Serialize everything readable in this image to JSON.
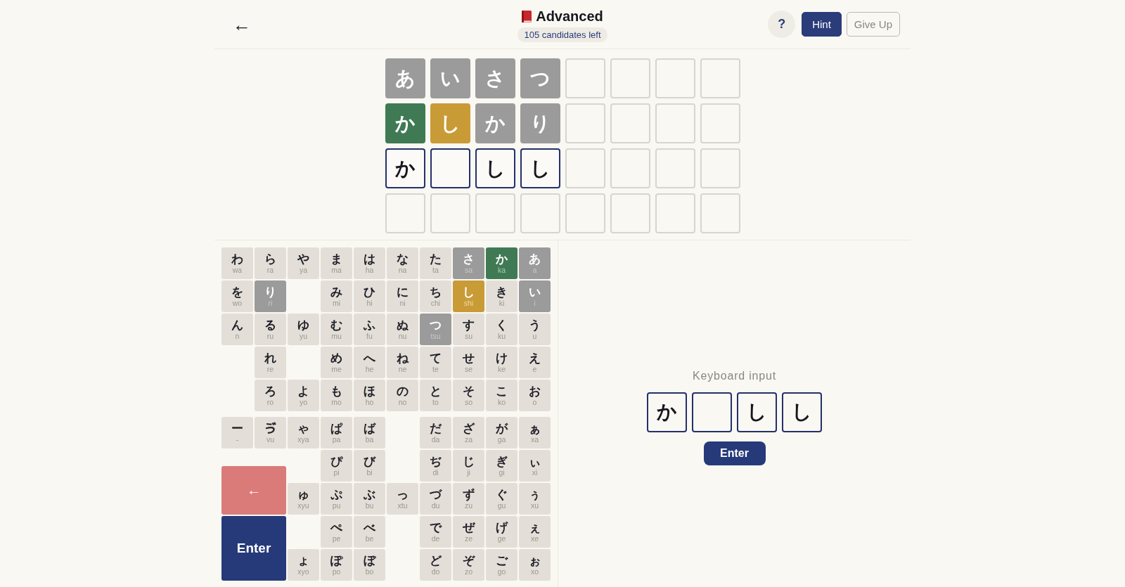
{
  "header": {
    "back": "←",
    "title": "Advanced",
    "badge": "105 candidates left",
    "help": "?",
    "buttons": [
      {
        "label": "Hint",
        "kind": "primary"
      },
      {
        "label": "Give Up",
        "kind": "outline"
      }
    ]
  },
  "board": {
    "rows": [
      [
        {
          "letter": "あ",
          "kind": "absent"
        },
        {
          "letter": "い",
          "kind": "absent"
        },
        {
          "letter": "さ",
          "kind": "absent"
        },
        {
          "letter": "つ",
          "kind": "absent"
        },
        {
          "kind": "empty"
        },
        {
          "kind": "empty"
        },
        {
          "kind": "empty"
        },
        {
          "kind": "empty"
        }
      ],
      [
        {
          "letter": "か",
          "kind": "correct"
        },
        {
          "letter": "し",
          "kind": "present"
        },
        {
          "letter": "か",
          "kind": "absent"
        },
        {
          "letter": "り",
          "kind": "absent"
        },
        {
          "kind": "empty"
        },
        {
          "kind": "empty"
        },
        {
          "kind": "empty"
        },
        {
          "kind": "empty"
        }
      ],
      [
        {
          "letter": "か",
          "kind": "input"
        },
        {
          "kind": "input"
        },
        {
          "letter": "し",
          "kind": "input"
        },
        {
          "letter": "し",
          "kind": "input"
        },
        {
          "kind": "empty"
        },
        {
          "kind": "empty"
        },
        {
          "kind": "empty"
        },
        {
          "kind": "empty"
        }
      ],
      [
        {
          "kind": "empty"
        },
        {
          "kind": "empty"
        },
        {
          "kind": "empty"
        },
        {
          "kind": "empty"
        },
        {
          "kind": "empty"
        },
        {
          "kind": "empty"
        },
        {
          "kind": "empty"
        },
        {
          "kind": "empty"
        }
      ]
    ]
  },
  "keyboard": {
    "main_rows": [
      [
        {
          "kana": "わ",
          "romaji": "wa",
          "kind": "unused"
        },
        {
          "kana": "ら",
          "romaji": "ra",
          "kind": "unused"
        },
        {
          "kana": "や",
          "romaji": "ya",
          "kind": "unused"
        },
        {
          "kana": "ま",
          "romaji": "ma",
          "kind": "unused"
        },
        {
          "kana": "は",
          "romaji": "ha",
          "kind": "unused"
        },
        {
          "kana": "な",
          "romaji": "na",
          "kind": "unused"
        },
        {
          "kana": "た",
          "romaji": "ta",
          "kind": "unused"
        },
        {
          "kana": "さ",
          "romaji": "sa",
          "kind": "absent"
        },
        {
          "kana": "か",
          "romaji": "ka",
          "kind": "correct"
        },
        {
          "kana": "あ",
          "romaji": "a",
          "kind": "absent"
        }
      ],
      [
        {
          "kana": "を",
          "romaji": "wo",
          "kind": "unused"
        },
        {
          "kana": "り",
          "romaji": "ri",
          "kind": "absent"
        },
        null,
        {
          "kana": "み",
          "romaji": "mi",
          "kind": "unused"
        },
        {
          "kana": "ひ",
          "romaji": "hi",
          "kind": "unused"
        },
        {
          "kana": "に",
          "romaji": "ni",
          "kind": "unused"
        },
        {
          "kana": "ち",
          "romaji": "chi",
          "kind": "unused"
        },
        {
          "kana": "し",
          "romaji": "shi",
          "kind": "present"
        },
        {
          "kana": "き",
          "romaji": "ki",
          "kind": "unused"
        },
        {
          "kana": "い",
          "romaji": "i",
          "kind": "absent"
        }
      ],
      [
        {
          "kana": "ん",
          "romaji": "n",
          "kind": "unused"
        },
        {
          "kana": "る",
          "romaji": "ru",
          "kind": "unused"
        },
        {
          "kana": "ゆ",
          "romaji": "yu",
          "kind": "unused"
        },
        {
          "kana": "む",
          "romaji": "mu",
          "kind": "unused"
        },
        {
          "kana": "ふ",
          "romaji": "fu",
          "kind": "unused"
        },
        {
          "kana": "ぬ",
          "romaji": "nu",
          "kind": "unused"
        },
        {
          "kana": "つ",
          "romaji": "tsu",
          "kind": "absent"
        },
        {
          "kana": "す",
          "romaji": "su",
          "kind": "unused"
        },
        {
          "kana": "く",
          "romaji": "ku",
          "kind": "unused"
        },
        {
          "kana": "う",
          "romaji": "u",
          "kind": "unused"
        }
      ],
      [
        null,
        {
          "kana": "れ",
          "romaji": "re",
          "kind": "unused"
        },
        null,
        {
          "kana": "め",
          "romaji": "me",
          "kind": "unused"
        },
        {
          "kana": "へ",
          "romaji": "he",
          "kind": "unused"
        },
        {
          "kana": "ね",
          "romaji": "ne",
          "kind": "unused"
        },
        {
          "kana": "て",
          "romaji": "te",
          "kind": "unused"
        },
        {
          "kana": "せ",
          "romaji": "se",
          "kind": "unused"
        },
        {
          "kana": "け",
          "romaji": "ke",
          "kind": "unused"
        },
        {
          "kana": "え",
          "romaji": "e",
          "kind": "unused"
        }
      ],
      [
        null,
        {
          "kana": "ろ",
          "romaji": "ro",
          "kind": "unused"
        },
        {
          "kana": "よ",
          "romaji": "yo",
          "kind": "unused"
        },
        {
          "kana": "も",
          "romaji": "mo",
          "kind": "unused"
        },
        {
          "kana": "ほ",
          "romaji": "ho",
          "kind": "unused"
        },
        {
          "kana": "の",
          "romaji": "no",
          "kind": "unused"
        },
        {
          "kana": "と",
          "romaji": "to",
          "kind": "unused"
        },
        {
          "kana": "そ",
          "romaji": "so",
          "kind": "unused"
        },
        {
          "kana": "こ",
          "romaji": "ko",
          "kind": "unused"
        },
        {
          "kana": "お",
          "romaji": "o",
          "kind": "unused"
        }
      ]
    ],
    "extra_rows": [
      [
        {
          "kana": "ー",
          "romaji": "-",
          "kind": "unused"
        },
        {
          "kana": "ゔ",
          "romaji": "vu",
          "kind": "unused"
        },
        {
          "kana": "ゃ",
          "romaji": "xya",
          "kind": "unused"
        },
        {
          "kana": "ぱ",
          "romaji": "pa",
          "kind": "unused"
        },
        {
          "kana": "ば",
          "romaji": "ba",
          "kind": "unused"
        },
        null,
        {
          "kana": "だ",
          "romaji": "da",
          "kind": "unused"
        },
        {
          "kana": "ざ",
          "romaji": "za",
          "kind": "unused"
        },
        {
          "kana": "が",
          "romaji": "ga",
          "kind": "unused"
        },
        {
          "kana": "ぁ",
          "romaji": "xa",
          "kind": "unused"
        }
      ],
      [
        null,
        {
          "kana": "ぴ",
          "romaji": "pi",
          "kind": "unused"
        },
        {
          "kana": "び",
          "romaji": "bi",
          "kind": "unused"
        },
        null,
        {
          "kana": "ぢ",
          "romaji": "di",
          "kind": "unused"
        },
        {
          "kana": "じ",
          "romaji": "ji",
          "kind": "unused"
        },
        {
          "kana": "ぎ",
          "romaji": "gi",
          "kind": "unused"
        },
        {
          "kana": "ぃ",
          "romaji": "xi",
          "kind": "unused"
        }
      ],
      [
        {
          "kana": "ゅ",
          "romaji": "xyu",
          "kind": "unused"
        },
        {
          "kana": "ぷ",
          "romaji": "pu",
          "kind": "unused"
        },
        {
          "kana": "ぶ",
          "romaji": "bu",
          "kind": "unused"
        },
        {
          "kana": "っ",
          "romaji": "xtu",
          "kind": "unused"
        },
        {
          "kana": "づ",
          "romaji": "du",
          "kind": "unused"
        },
        {
          "kana": "ず",
          "romaji": "zu",
          "kind": "unused"
        },
        {
          "kana": "ぐ",
          "romaji": "gu",
          "kind": "unused"
        },
        {
          "kana": "ぅ",
          "romaji": "xu",
          "kind": "unused"
        }
      ],
      [
        null,
        {
          "kana": "ぺ",
          "romaji": "pe",
          "kind": "unused"
        },
        {
          "kana": "べ",
          "romaji": "be",
          "kind": "unused"
        },
        null,
        {
          "kana": "で",
          "romaji": "de",
          "kind": "unused"
        },
        {
          "kana": "ぜ",
          "romaji": "ze",
          "kind": "unused"
        },
        {
          "kana": "げ",
          "romaji": "ge",
          "kind": "unused"
        },
        {
          "kana": "ぇ",
          "romaji": "xe",
          "kind": "unused"
        }
      ],
      [
        {
          "kana": "ょ",
          "romaji": "xyo",
          "kind": "unused"
        },
        {
          "kana": "ぽ",
          "romaji": "po",
          "kind": "unused"
        },
        {
          "kana": "ぼ",
          "romaji": "bo",
          "kind": "unused"
        },
        null,
        {
          "kana": "ど",
          "romaji": "do",
          "kind": "unused"
        },
        {
          "kana": "ぞ",
          "romaji": "zo",
          "kind": "unused"
        },
        {
          "kana": "ご",
          "romaji": "go",
          "kind": "unused"
        },
        {
          "kana": "ぉ",
          "romaji": "xo",
          "kind": "unused"
        }
      ]
    ],
    "backspace": "←",
    "enter": "Enter"
  },
  "input_panel": {
    "label": "Keyboard input",
    "cells": [
      "か",
      null,
      "し",
      "し"
    ],
    "enter": "Enter"
  }
}
